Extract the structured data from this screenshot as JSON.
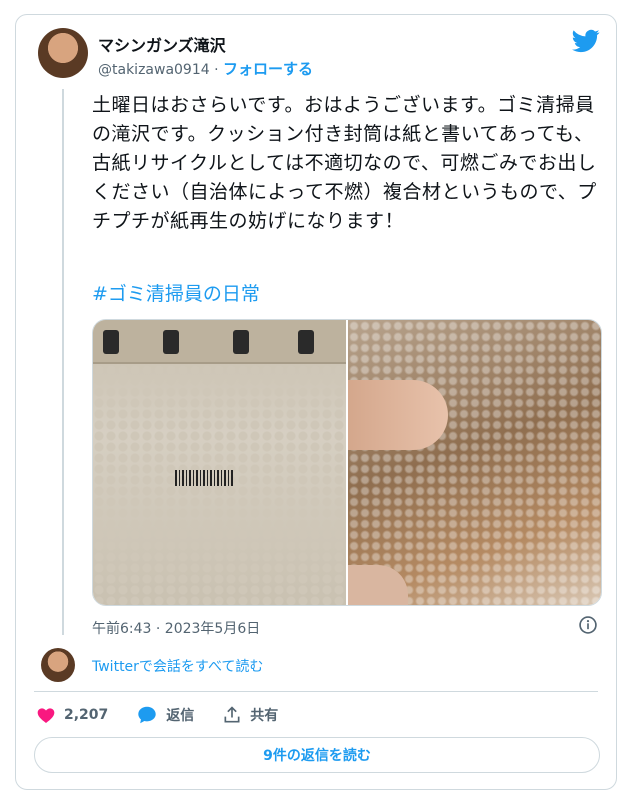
{
  "tweet": {
    "author_name": "マシンガンズ滝沢",
    "handle": "@takizawa0914",
    "separator": " · ",
    "follow_label": "フォローする",
    "text": "土曜日はおさらいです。おはようございます。ゴミ清掃員の滝沢です。クッション付き封筒は紙と書いてあっても、古紙リサイクルとしては不適切なので、可燃ごみでお出しください（自治体によって不燃）複合材というもので、プチプチが紙再生の妨げになります！",
    "hashtag": "#ゴミ清掃員の日常",
    "timestamp": "午前6:43 · 2023年5月6日",
    "read_conversation": "Twitterで会話をすべて読む",
    "likes": "2,207",
    "reply_label": "返信",
    "share_label": "共有",
    "read_replies_label": "9件の返信を読む"
  },
  "colors": {
    "accent": "#1d9bf0",
    "like": "#f91880",
    "muted": "#536471",
    "border": "#cfd9de"
  },
  "icons": [
    "twitter-logo-icon",
    "info-icon",
    "heart-icon",
    "reply-icon",
    "share-icon"
  ]
}
